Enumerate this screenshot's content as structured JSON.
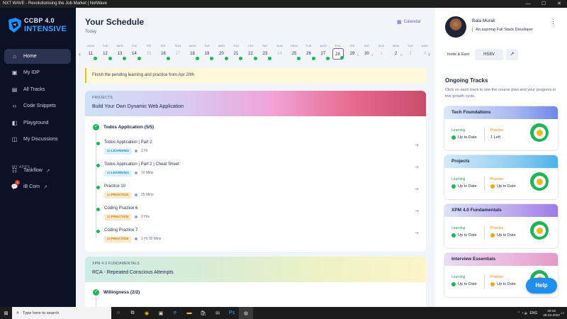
{
  "window": {
    "title": "NXT WAVE - Revolutionising the Job Market | NxtWave"
  },
  "brand": {
    "line1": "CCBP 4.0",
    "line2": "INTENSIVE",
    "accent": "#3aa0ff"
  },
  "nav": [
    {
      "label": "Home",
      "icon": "home-icon",
      "active": true
    },
    {
      "label": "My IDP",
      "icon": "idp-icon"
    },
    {
      "label": "All Tracks",
      "icon": "tracks-icon"
    },
    {
      "label": "Code Snippets",
      "icon": "code-icon"
    },
    {
      "label": "Playground",
      "icon": "playground-icon"
    },
    {
      "label": "My Discussions",
      "icon": "discussions-icon"
    }
  ],
  "apps_header": "MY APPS",
  "apps": [
    {
      "label": "Taskflow",
      "icon": "taskflow-icon"
    },
    {
      "label": "iB Com",
      "icon": "chat-icon",
      "badge": "1"
    }
  ],
  "schedule": {
    "title": "Your Schedule",
    "today": "Today",
    "calendar_label": "Calendar",
    "days": [
      {
        "n": "MON",
        "d": "11",
        "done": true
      },
      {
        "n": "TUE",
        "d": "12",
        "done": true
      },
      {
        "n": "WED",
        "d": "13",
        "done": true
      },
      {
        "n": "THU",
        "d": "14",
        "done": true
      },
      {
        "n": "FRI",
        "d": "15",
        "off": true
      },
      {
        "n": "SAT",
        "d": "16",
        "done": true
      },
      {
        "n": "SUN",
        "d": "17",
        "off": true
      },
      {
        "n": "MON",
        "d": "18",
        "done": true
      },
      {
        "n": "TUE",
        "d": "19",
        "done": true
      },
      {
        "n": "WED",
        "d": "20",
        "done": true
      },
      {
        "n": "THU",
        "d": "21",
        "done": true
      },
      {
        "n": "FRI",
        "d": "22",
        "done": true
      },
      {
        "n": "SAT",
        "d": "23",
        "done": true
      },
      {
        "n": "SUN",
        "d": "24",
        "off": true
      },
      {
        "n": "MON",
        "d": "25",
        "done": true
      },
      {
        "n": "TUE",
        "d": "26",
        "done": true
      },
      {
        "n": "WED",
        "d": "27",
        "done": true
      },
      {
        "n": "THU",
        "d": "28",
        "done": true,
        "selected": true
      },
      {
        "n": "FRI",
        "d": "29",
        "sub": "3"
      },
      {
        "n": "SAT",
        "d": "30",
        "sub": "3"
      },
      {
        "n": "SUN",
        "d": "1",
        "off": true
      },
      {
        "n": "MON",
        "d": "2",
        "sub": "3"
      },
      {
        "n": "TUE",
        "d": "3",
        "off": true
      },
      {
        "n": "WED",
        "d": "4",
        "off": true
      }
    ],
    "alert": "Finish the pending learning and practice from Apr 20th"
  },
  "card1": {
    "kicker": "PROJECTS",
    "title": "Build Your Own Dynamic Web Application",
    "section": "Todos Application (5/5)",
    "items": [
      {
        "name": "Todos Application | Part 2",
        "tag": "LEARNING",
        "dur": "1 Hr"
      },
      {
        "name": "Todos Application | Part 2 | Cheat Sheet",
        "tag": "LEARNING",
        "dur": "10 Mins"
      },
      {
        "name": "Practice 10",
        "tag": "PRACTICE",
        "dur": "25 Mins"
      },
      {
        "name": "Coding Practice 6",
        "tag": "PRACTICE",
        "dur": "2 Hrs"
      },
      {
        "name": "Coding Practice 7",
        "tag": "PRACTICE",
        "dur": "1 Hr 30 Mins"
      }
    ]
  },
  "card2": {
    "kicker": "XPM 4.0 FUNDAMENTALS",
    "title": "RCA - Repeated Conscious Attempts",
    "section": "Willingness (2/2)"
  },
  "profile": {
    "name": "Bala  Murali",
    "tagline": "An aspiring Full Stack Developer",
    "invite_label": "Invite & Earn",
    "invite_code": "HS8V"
  },
  "tracks_panel": {
    "title": "Ongoing Tracks",
    "subtitle": "Click on each track to see the course plan and your progress in this growth cycle."
  },
  "tracks": [
    {
      "name": "Tech Foundations",
      "learning": "Up to Date",
      "practice": "1 Left",
      "color": "#6f87e8"
    },
    {
      "name": "Projects",
      "learning": "Up to Date",
      "practice": "Up to Date",
      "color": "#4db2ea"
    },
    {
      "name": "XPM 4.0 Fundamentals",
      "learning": "Up to Date",
      "practice": "Up to Date",
      "color": "#9b7ce6"
    },
    {
      "name": "Interview Essentials",
      "learning": "Up to Date",
      "practice": "Up to Date",
      "color": "#e59ac6"
    }
  ],
  "track_labels": {
    "learning": "Learning",
    "practice": "Practice"
  },
  "help_label": "Help",
  "taskbar": {
    "search_placeholder": "Type here to search",
    "lang": "ENG",
    "time": "20:19",
    "date": "28-04-2022"
  }
}
